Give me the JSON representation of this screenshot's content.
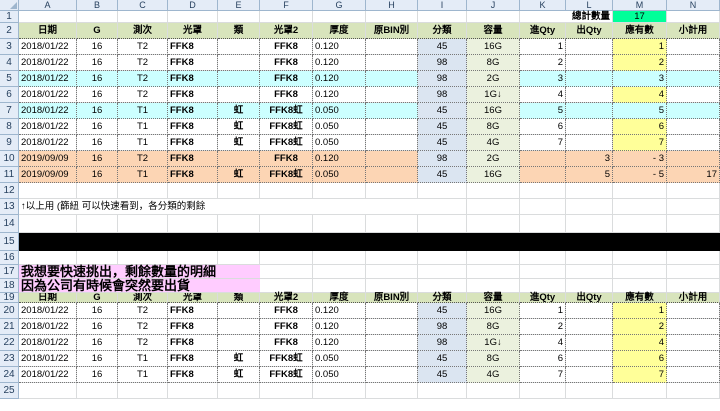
{
  "columns": [
    "A",
    "B",
    "C",
    "D",
    "E",
    "F",
    "G",
    "H",
    "I",
    "J",
    "K",
    "L",
    "M",
    "N"
  ],
  "rows": [
    "1",
    "2",
    "3",
    "4",
    "5",
    "6",
    "7",
    "8",
    "9",
    "10",
    "11",
    "12",
    "13",
    "14",
    "15",
    "16",
    "17",
    "18",
    "19",
    "20",
    "21",
    "22",
    "23",
    "24",
    "25"
  ],
  "summary": {
    "label": "總計數量",
    "value": "17"
  },
  "headers": [
    "日期",
    "G",
    "測次",
    "光罩",
    "類",
    "光罩2",
    "厚度",
    "原BIN別",
    "分類",
    "容量",
    "進Qty",
    "出Qty",
    "應有數",
    "小計用"
  ],
  "table1": [
    [
      "2018/01/22",
      "16",
      "T2",
      "FFK8",
      "",
      "FFK8",
      "0.120",
      "",
      "45",
      "16G",
      "1",
      "",
      "1",
      ""
    ],
    [
      "2018/01/22",
      "16",
      "T2",
      "FFK8",
      "",
      "FFK8",
      "0.120",
      "",
      "98",
      "8G",
      "2",
      "",
      "2",
      ""
    ],
    [
      "2018/01/22",
      "16",
      "T2",
      "FFK8",
      "",
      "FFK8",
      "0.120",
      "",
      "98",
      "2G",
      "3",
      "",
      "3",
      ""
    ],
    [
      "2018/01/22",
      "16",
      "T2",
      "FFK8",
      "",
      "FFK8",
      "0.120",
      "",
      "98",
      "1G↓",
      "4",
      "",
      "4",
      ""
    ],
    [
      "2018/01/22",
      "16",
      "T1",
      "FFK8",
      "虹",
      "FFK8虹",
      "0.050",
      "",
      "45",
      "16G",
      "5",
      "",
      "5",
      ""
    ],
    [
      "2018/01/22",
      "16",
      "T1",
      "FFK8",
      "虹",
      "FFK8虹",
      "0.050",
      "",
      "45",
      "8G",
      "6",
      "",
      "6",
      ""
    ],
    [
      "2018/01/22",
      "16",
      "T1",
      "FFK8",
      "虹",
      "FFK8虹",
      "0.050",
      "",
      "45",
      "4G",
      "7",
      "",
      "7",
      ""
    ],
    [
      "2019/09/09",
      "16",
      "T2",
      "FFK8",
      "",
      "FFK8",
      "0.120",
      "",
      "98",
      "2G",
      "",
      "3",
      "-   3",
      ""
    ],
    [
      "2019/09/09",
      "16",
      "T1",
      "FFK8",
      "虹",
      "FFK8虹",
      "0.050",
      "",
      "45",
      "16G",
      "",
      "5",
      "-   5",
      "17"
    ]
  ],
  "note": "↑以上用  (篩紐  可以快速看到，各分類的剩餘",
  "question_line1": "我想要快速挑出，剩餘數量的明細",
  "question_line2": "因為公司有時候會突然要出貨",
  "table2": [
    [
      "2018/01/22",
      "16",
      "T2",
      "FFK8",
      "",
      "FFK8",
      "0.120",
      "",
      "45",
      "16G",
      "1",
      "",
      "1",
      ""
    ],
    [
      "2018/01/22",
      "16",
      "T2",
      "FFK8",
      "",
      "FFK8",
      "0.120",
      "",
      "98",
      "8G",
      "2",
      "",
      "2",
      ""
    ],
    [
      "2018/01/22",
      "16",
      "T2",
      "FFK8",
      "",
      "FFK8",
      "0.120",
      "",
      "98",
      "1G↓",
      "4",
      "",
      "4",
      ""
    ],
    [
      "2018/01/22",
      "16",
      "T1",
      "FFK8",
      "虹",
      "FFK8虹",
      "0.050",
      "",
      "45",
      "8G",
      "6",
      "",
      "6",
      ""
    ],
    [
      "2018/01/22",
      "16",
      "T1",
      "FFK8",
      "虹",
      "FFK8虹",
      "0.050",
      "",
      "45",
      "4G",
      "7",
      "",
      "7",
      ""
    ]
  ],
  "colors": {
    "header_bg": "#d8e4bc",
    "summary_bg": "#00ff99",
    "cyan_row": "#ccffff",
    "orange_row": "#fcd5b4",
    "pink_note": "#ffccff",
    "black_bar": "#000000"
  }
}
